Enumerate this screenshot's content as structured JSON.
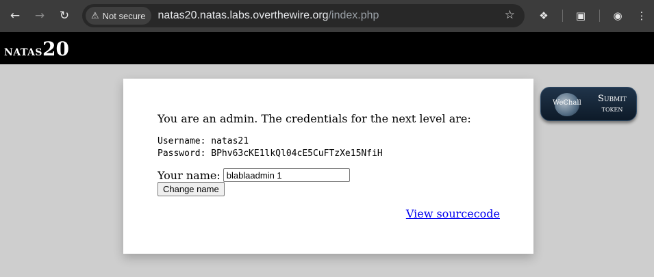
{
  "browser": {
    "security_label": "Not secure",
    "url_host": "natas20.natas.labs.overthewire.org",
    "url_path": "/index.php",
    "icons": [
      "back-arrow-icon",
      "forward-arrow-icon",
      "reload-icon",
      "warning-icon",
      "star-icon",
      "extensions-icon",
      "tab-search-icon",
      "profile-icon",
      "kebab-menu-icon"
    ]
  },
  "header": {
    "title_small": "natas",
    "title_number": "20"
  },
  "main": {
    "message": "You are an admin. The credentials for the next level are:",
    "credentials": "Username: natas21\nPassword: BPhv63cKE1lkQl04cE5CuFTzXe15NfiH",
    "name_label": "Your name:",
    "name_value": "blablaadmin 1",
    "change_button": "Change name",
    "source_link": "View sourcecode"
  },
  "token_widget": {
    "brand": "WeChall",
    "line1": "Submit",
    "line2": "token"
  }
}
